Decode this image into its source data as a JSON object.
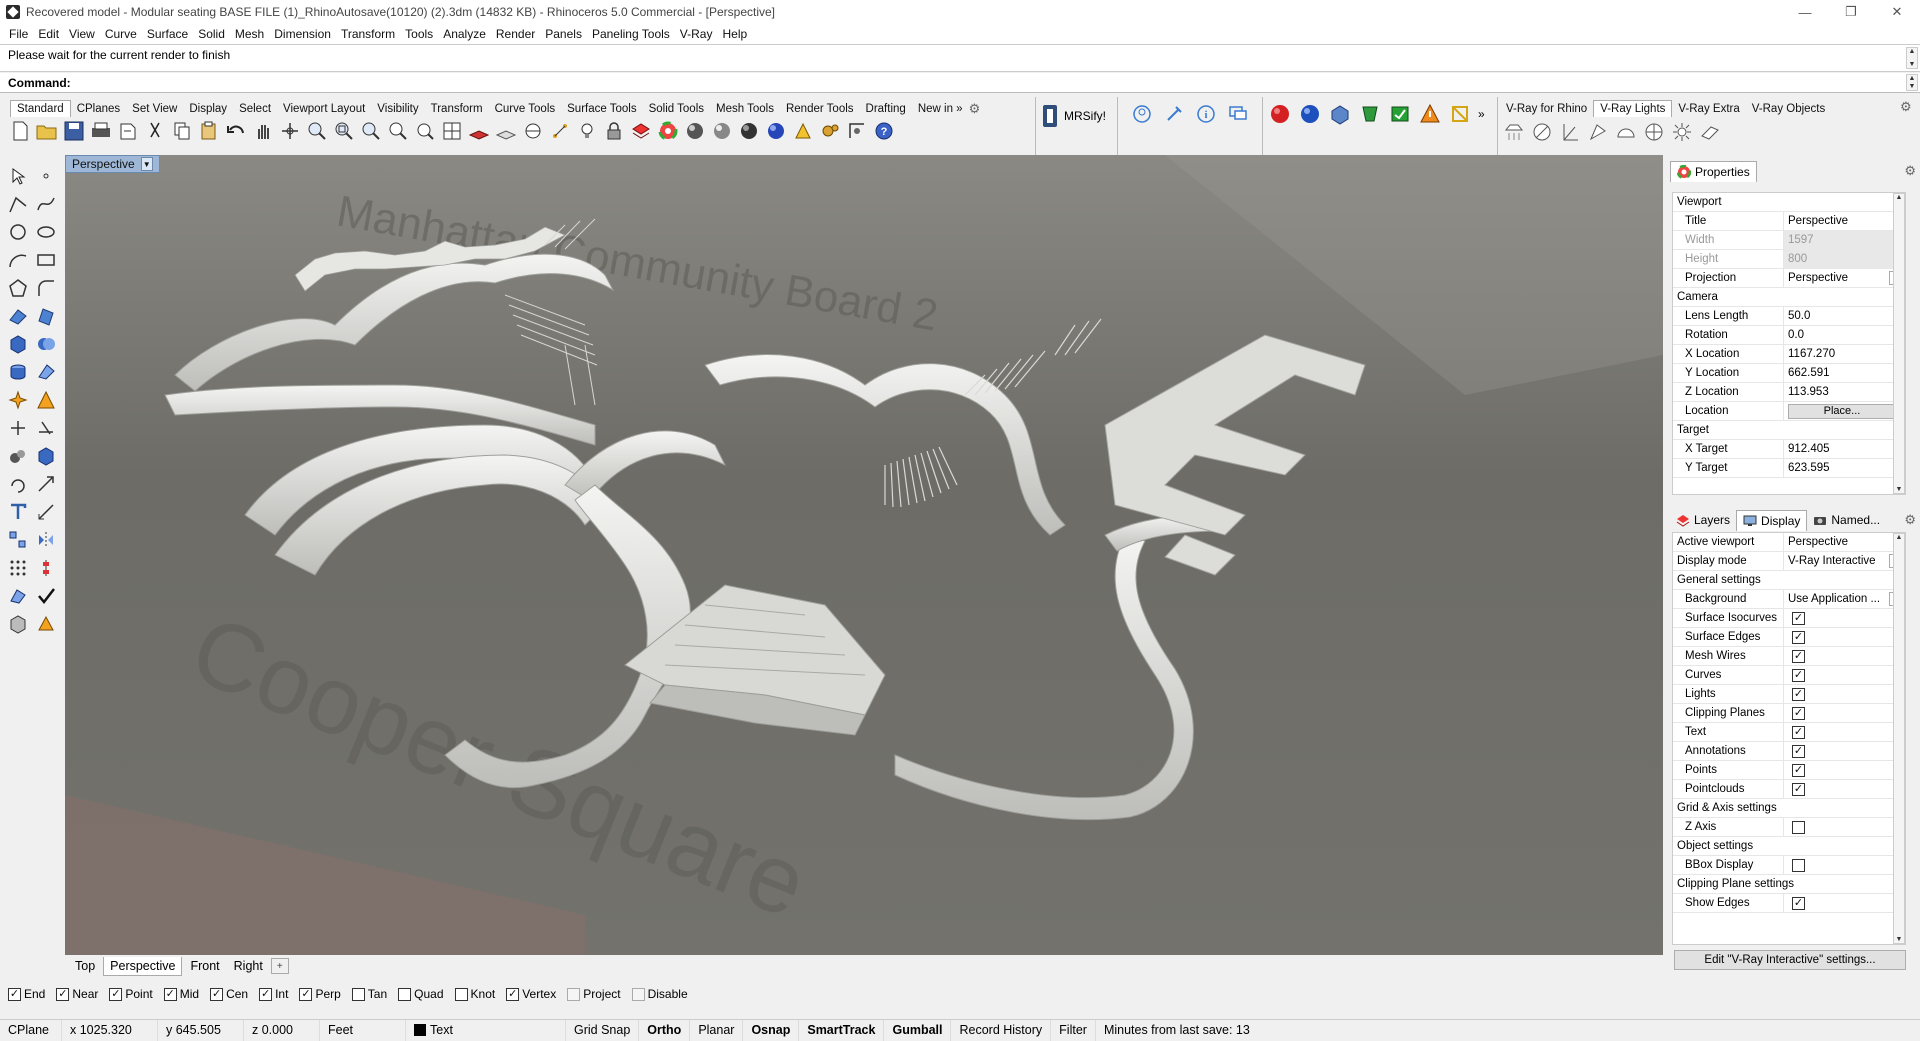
{
  "window": {
    "title": "Recovered model - Modular seating BASE FILE (1)_RhinoAutosave(10120) (2).3dm (14832 KB) - Rhinoceros 5.0 Commercial - [Perspective]",
    "minimize": "—",
    "restore": "❐",
    "close": "✕"
  },
  "menu": [
    "File",
    "Edit",
    "View",
    "Curve",
    "Surface",
    "Solid",
    "Mesh",
    "Dimension",
    "Transform",
    "Tools",
    "Analyze",
    "Render",
    "Panels",
    "Paneling Tools",
    "V-Ray",
    "Help"
  ],
  "command": {
    "history": "Please wait for the current render to finish",
    "prompt_label": "Command:"
  },
  "toolbar_tabs": [
    "Standard",
    "CPlanes",
    "Set View",
    "Display",
    "Select",
    "Viewport Layout",
    "Visibility",
    "Transform",
    "Curve Tools",
    "Surface Tools",
    "Solid Tools",
    "Mesh Tools",
    "Render Tools",
    "Drafting",
    "New in »"
  ],
  "mrsify_label": "MRSify!",
  "vray_tabs": [
    "V-Ray for Rhino",
    "V-Ray Lights",
    "V-Ray Extra",
    "V-Ray Objects"
  ],
  "viewport": {
    "title": "Perspective",
    "dropdown_icon": "▼",
    "map_text_1": "Manhattan Community Board 2",
    "map_text_2": "Cooper Square",
    "tabs": [
      "Top",
      "Perspective",
      "Front",
      "Right"
    ],
    "add_tab": "+"
  },
  "osnaps": [
    {
      "label": "End",
      "checked": true
    },
    {
      "label": "Near",
      "checked": true
    },
    {
      "label": "Point",
      "checked": true
    },
    {
      "label": "Mid",
      "checked": true
    },
    {
      "label": "Cen",
      "checked": true
    },
    {
      "label": "Int",
      "checked": true
    },
    {
      "label": "Perp",
      "checked": true
    },
    {
      "label": "Tan",
      "checked": false
    },
    {
      "label": "Quad",
      "checked": false
    },
    {
      "label": "Knot",
      "checked": false
    },
    {
      "label": "Vertex",
      "checked": true
    },
    {
      "label": "Project",
      "checked": false
    },
    {
      "label": "Disable",
      "checked": false
    }
  ],
  "status": {
    "cplane": "CPlane",
    "x": "x 1025.320",
    "y": "y 645.505",
    "z": "z 0.000",
    "units": "Feet",
    "layer": "Text",
    "grid_snap": "Grid Snap",
    "ortho": "Ortho",
    "planar": "Planar",
    "osnap": "Osnap",
    "smarttrack": "SmartTrack",
    "gumball": "Gumball",
    "record_history": "Record History",
    "filter": "Filter",
    "last_save": "Minutes from last save: 13"
  },
  "properties": {
    "tab_label": "Properties",
    "section_viewport": "Viewport",
    "rows_viewport": [
      {
        "k": "Title",
        "v": "Perspective"
      },
      {
        "k": "Width",
        "v": "1597",
        "dim": true
      },
      {
        "k": "Height",
        "v": "800",
        "dim": true
      },
      {
        "k": "Projection",
        "v": "Perspective",
        "select": true
      }
    ],
    "section_camera": "Camera",
    "rows_camera": [
      {
        "k": "Lens Length",
        "v": "50.0"
      },
      {
        "k": "Rotation",
        "v": "0.0"
      },
      {
        "k": "X Location",
        "v": "1167.270"
      },
      {
        "k": "Y Location",
        "v": "662.591"
      },
      {
        "k": "Z Location",
        "v": "113.953"
      },
      {
        "k": "Location",
        "v": "Place...",
        "button": true
      }
    ],
    "section_target": "Target",
    "rows_target": [
      {
        "k": "X Target",
        "v": "912.405"
      },
      {
        "k": "Y Target",
        "v": "623.595"
      }
    ]
  },
  "display_panel": {
    "tabs": [
      "Layers",
      "Display",
      "Named..."
    ],
    "active_viewport_label": "Active viewport",
    "active_viewport_value": "Perspective",
    "display_mode_label": "Display mode",
    "display_mode_value": "V-Ray Interactive",
    "general_settings": "General settings",
    "background_label": "Background",
    "background_value": "Use Application ...",
    "checks": [
      {
        "k": "Surface Isocurves",
        "checked": true
      },
      {
        "k": "Surface Edges",
        "checked": true
      },
      {
        "k": "Mesh Wires",
        "checked": true
      },
      {
        "k": "Curves",
        "checked": true
      },
      {
        "k": "Lights",
        "checked": true
      },
      {
        "k": "Clipping Planes",
        "checked": true
      },
      {
        "k": "Text",
        "checked": true
      },
      {
        "k": "Annotations",
        "checked": true
      },
      {
        "k": "Points",
        "checked": true
      },
      {
        "k": "Pointclouds",
        "checked": true
      }
    ],
    "grid_axis": "Grid & Axis settings",
    "z_axis": {
      "k": "Z Axis",
      "checked": false
    },
    "object_settings": "Object settings",
    "bbox": {
      "k": "BBox Display",
      "checked": false
    },
    "clipping_settings": "Clipping Plane settings",
    "show_edges": {
      "k": "Show Edges",
      "checked": true
    },
    "edit_button": "Edit \"V-Ray Interactive\" settings..."
  },
  "colors": {
    "viewport_tab": "#9fb7d6",
    "model": "#e8e8e6",
    "floor": "#6e6d67"
  }
}
